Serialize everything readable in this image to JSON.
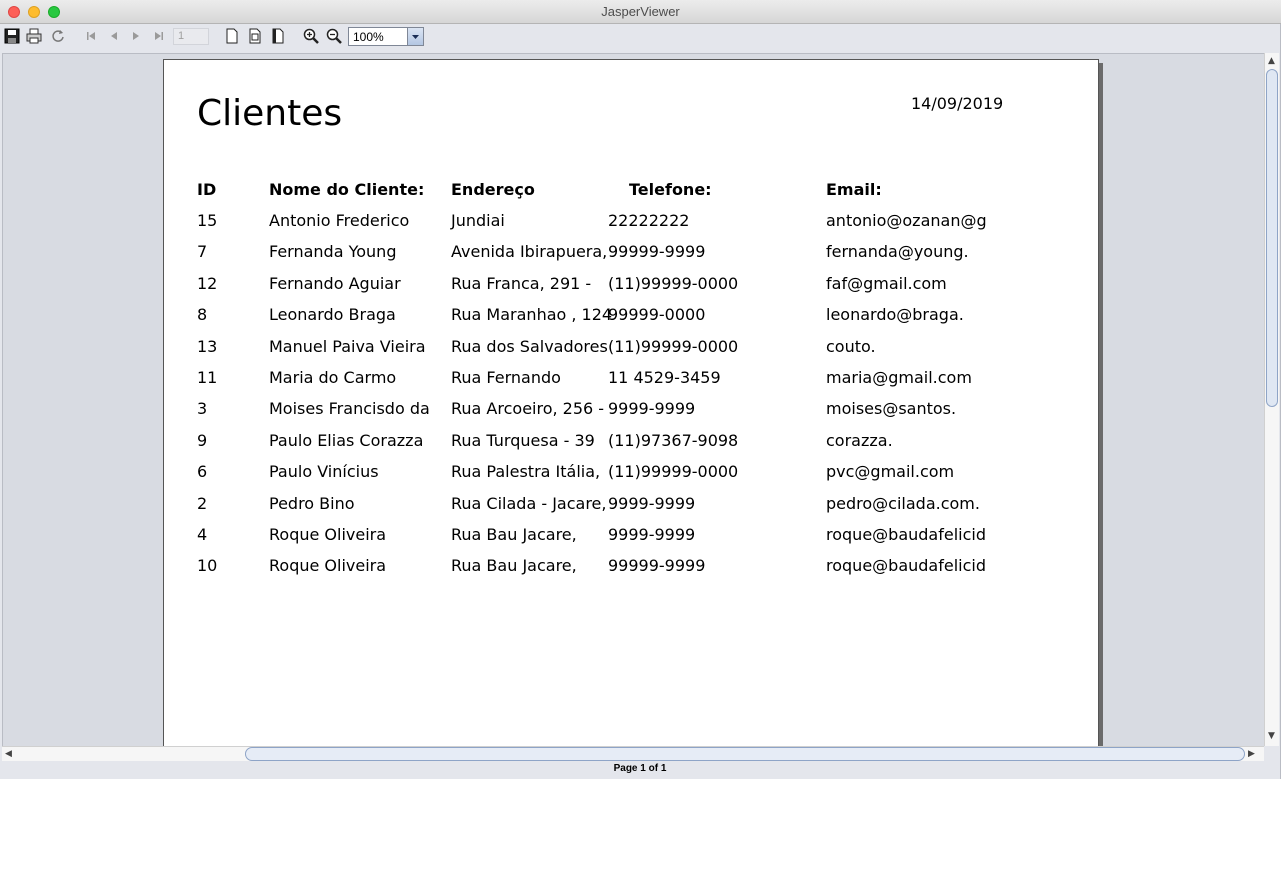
{
  "window": {
    "title": "JasperViewer"
  },
  "toolbar": {
    "page_number": "1",
    "zoom": "100%",
    "icons": [
      "save-icon",
      "print-icon",
      "reload-icon",
      "first-page-icon",
      "previous-page-icon",
      "next-page-icon",
      "last-page-icon",
      "actual-size-icon",
      "fit-page-icon",
      "fit-width-icon",
      "zoom-in-icon",
      "zoom-out-icon"
    ]
  },
  "report": {
    "title": "Clientes",
    "date": "14/09/2019",
    "headers": {
      "id": "ID",
      "nome": "Nome do Cliente:",
      "endereco": "Endereço",
      "telefone": "Telefone:",
      "email": "Email:"
    },
    "rows": [
      {
        "id": "15",
        "nome": "Antonio Frederico",
        "endereco": "Jundiai",
        "telefone": "22222222",
        "email": "antonio@ozanan@g"
      },
      {
        "id": "7",
        "nome": "Fernanda Young",
        "endereco": "Avenida Ibirapuera,",
        "telefone": "99999-9999",
        "email": "fernanda@young."
      },
      {
        "id": "12",
        "nome": "Fernando Aguiar",
        "endereco": "Rua Franca, 291 -",
        "telefone": "(11)99999-0000",
        "email": "faf@gmail.com"
      },
      {
        "id": "8",
        "nome": "Leonardo Braga",
        "endereco": "Rua Maranhao , 124",
        "telefone": "99999-0000",
        "email": "leonardo@braga."
      },
      {
        "id": "13",
        "nome": "Manuel Paiva Vieira",
        "endereco": "Rua dos Salvadores",
        "telefone": "(11)99999-0000",
        "email": "couto."
      },
      {
        "id": "11",
        "nome": "Maria do Carmo",
        "endereco": "Rua Fernando",
        "telefone": "11 4529-3459",
        "email": "maria@gmail.com"
      },
      {
        "id": "3",
        "nome": "Moises Francisdo da",
        "endereco": "Rua Arcoeiro, 256 -",
        "telefone": "9999-9999",
        "email": "moises@santos."
      },
      {
        "id": "9",
        "nome": "Paulo Elias Corazza",
        "endereco": "Rua Turquesa - 39",
        "telefone": "(11)97367-9098",
        "email": "corazza."
      },
      {
        "id": "6",
        "nome": "Paulo Vinícius",
        "endereco": "Rua Palestra Itália,",
        "telefone": "(11)99999-0000",
        "email": "pvc@gmail.com"
      },
      {
        "id": "2",
        "nome": "Pedro Bino",
        "endereco": "Rua Cilada - Jacare,",
        "telefone": "9999-9999",
        "email": "pedro@cilada.com."
      },
      {
        "id": "4",
        "nome": "Roque Oliveira",
        "endereco": "Rua Bau Jacare,",
        "telefone": "9999-9999",
        "email": "roque@baudafelicid"
      },
      {
        "id": "10",
        "nome": "Roque Oliveira",
        "endereco": "Rua Bau Jacare,",
        "telefone": "99999-9999",
        "email": "roque@baudafelicid"
      }
    ]
  },
  "status": {
    "page_info": "Page 1 of 1"
  },
  "colors": {
    "window_bg": "#e4e6ec",
    "viewport_bg": "#d8dbe2",
    "page_bg": "#ffffff",
    "scroll_thumb_border": "#8ea4c7"
  }
}
